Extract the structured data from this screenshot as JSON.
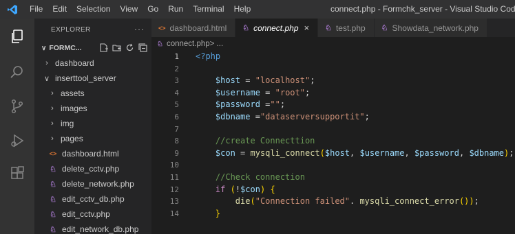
{
  "titlebar": {
    "menu": [
      "File",
      "Edit",
      "Selection",
      "View",
      "Go",
      "Run",
      "Terminal",
      "Help"
    ],
    "window_title": "connect.php - Formchk_server - Visual Studio Code"
  },
  "colors": {
    "accent": "#007acc",
    "php_icon": "#a074c4",
    "html_icon": "#e37933"
  },
  "sidebar": {
    "header": "EXPLORER",
    "more": "···",
    "section": "FORMC...",
    "tree": [
      {
        "label": "dashboard",
        "type": "folder",
        "expanded": false,
        "depth": 1
      },
      {
        "label": "inserttool_server",
        "type": "folder",
        "expanded": true,
        "depth": 1
      },
      {
        "label": "assets",
        "type": "folder",
        "expanded": false,
        "depth": 2
      },
      {
        "label": "images",
        "type": "folder",
        "expanded": false,
        "depth": 2
      },
      {
        "label": "img",
        "type": "folder",
        "expanded": false,
        "depth": 2
      },
      {
        "label": "pages",
        "type": "folder",
        "expanded": false,
        "depth": 2
      },
      {
        "label": "dashboard.html",
        "type": "html",
        "depth": 2
      },
      {
        "label": "delete_cctv.php",
        "type": "php",
        "depth": 2
      },
      {
        "label": "delete_network.php",
        "type": "php",
        "depth": 2
      },
      {
        "label": "edit_cctv_db.php",
        "type": "php",
        "depth": 2
      },
      {
        "label": "edit_cctv.php",
        "type": "php",
        "depth": 2
      },
      {
        "label": "edit_network_db.php",
        "type": "php",
        "depth": 2
      }
    ]
  },
  "tabs": [
    {
      "label": "dashboard.html",
      "icon": "html",
      "active": false
    },
    {
      "label": "connect.php",
      "icon": "php",
      "active": true,
      "close": "×"
    },
    {
      "label": "test.php",
      "icon": "php",
      "active": false
    },
    {
      "label": "Showdata_network.php",
      "icon": "php",
      "active": false
    }
  ],
  "breadcrumb": {
    "file": "connect.php",
    "rest": " > ..."
  },
  "code": {
    "lines": [
      {
        "n": "1",
        "tokens": [
          [
            "kw-tag",
            "<?php"
          ]
        ]
      },
      {
        "n": "2",
        "tokens": []
      },
      {
        "n": "3",
        "tokens": [
          [
            "txt",
            "    "
          ],
          [
            "var",
            "$host"
          ],
          [
            "op",
            " = "
          ],
          [
            "str",
            "\"localhost\""
          ],
          [
            "op",
            ";"
          ]
        ]
      },
      {
        "n": "4",
        "tokens": [
          [
            "txt",
            "    "
          ],
          [
            "var",
            "$username"
          ],
          [
            "op",
            " = "
          ],
          [
            "str",
            "\"root\""
          ],
          [
            "op",
            ";"
          ]
        ]
      },
      {
        "n": "5",
        "tokens": [
          [
            "txt",
            "    "
          ],
          [
            "var",
            "$password"
          ],
          [
            "op",
            " ="
          ],
          [
            "str",
            "\"\""
          ],
          [
            "op",
            ";"
          ]
        ]
      },
      {
        "n": "6",
        "tokens": [
          [
            "txt",
            "    "
          ],
          [
            "var",
            "$dbname"
          ],
          [
            "op",
            " ="
          ],
          [
            "str",
            "\"dataserversupportit\""
          ],
          [
            "op",
            ";"
          ]
        ]
      },
      {
        "n": "7",
        "tokens": []
      },
      {
        "n": "8",
        "tokens": [
          [
            "txt",
            "    "
          ],
          [
            "cmt",
            "//create Connecttion"
          ]
        ]
      },
      {
        "n": "9",
        "tokens": [
          [
            "txt",
            "    "
          ],
          [
            "var",
            "$con"
          ],
          [
            "op",
            " = "
          ],
          [
            "fn",
            "mysqli_connect"
          ],
          [
            "punc",
            "("
          ],
          [
            "var",
            "$host"
          ],
          [
            "op",
            ", "
          ],
          [
            "var",
            "$username"
          ],
          [
            "op",
            ", "
          ],
          [
            "var",
            "$password"
          ],
          [
            "op",
            ", "
          ],
          [
            "var",
            "$dbname"
          ],
          [
            "punc",
            ")"
          ],
          [
            "op",
            ";"
          ]
        ]
      },
      {
        "n": "10",
        "tokens": []
      },
      {
        "n": "11",
        "tokens": [
          [
            "txt",
            "    "
          ],
          [
            "cmt",
            "//Check connection"
          ]
        ]
      },
      {
        "n": "12",
        "tokens": [
          [
            "txt",
            "    "
          ],
          [
            "ctl",
            "if"
          ],
          [
            "op",
            " "
          ],
          [
            "punc",
            "("
          ],
          [
            "op",
            "!"
          ],
          [
            "var",
            "$con"
          ],
          [
            "punc",
            ")"
          ],
          [
            "op",
            " "
          ],
          [
            "punc",
            "{"
          ]
        ]
      },
      {
        "n": "13",
        "tokens": [
          [
            "txt",
            "        "
          ],
          [
            "fn",
            "die"
          ],
          [
            "punc",
            "("
          ],
          [
            "str",
            "\"Connection failed\""
          ],
          [
            "op",
            ". "
          ],
          [
            "fn",
            "mysqli_connect_error"
          ],
          [
            "punc",
            "()"
          ],
          [
            "punc",
            ")"
          ],
          [
            "op",
            ";"
          ]
        ]
      },
      {
        "n": "14",
        "tokens": [
          [
            "txt",
            "    "
          ],
          [
            "punc",
            "}"
          ]
        ]
      }
    ]
  }
}
